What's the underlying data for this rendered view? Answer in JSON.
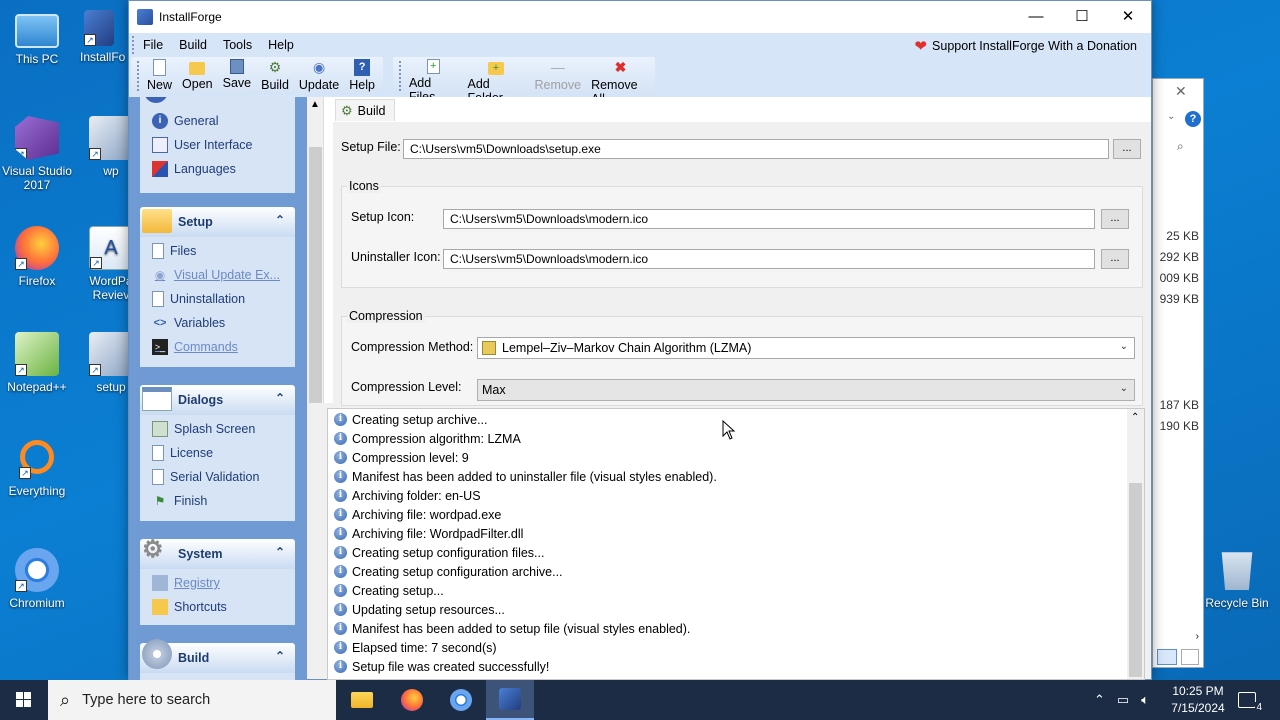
{
  "desktop": {
    "icons": [
      {
        "label": "This PC"
      },
      {
        "label": "InstallFo"
      },
      {
        "label": "Visual Studio 2017"
      },
      {
        "label": "wp"
      },
      {
        "label": "Firefox"
      },
      {
        "label": "WordPa Reviev"
      },
      {
        "label": "Notepad++"
      },
      {
        "label": "setup"
      },
      {
        "label": "Everything"
      },
      {
        "label": "Chromium"
      }
    ],
    "recycle_bin": "Recycle Bin",
    "bg_window_sizes": [
      "25 KB",
      "292 KB",
      "009 KB",
      "939 KB",
      "187 KB",
      "190 KB"
    ]
  },
  "window": {
    "title": "InstallForge",
    "controls": {
      "minimize": "—",
      "maximize": "☐",
      "close": "✕"
    }
  },
  "menu": {
    "items": [
      "File",
      "Build",
      "Tools",
      "Help"
    ],
    "donation": "Support InstallForge With a Donation"
  },
  "toolbar": {
    "group1": [
      {
        "label": "New",
        "icon": "new-file-icon"
      },
      {
        "label": "Open",
        "icon": "open-folder-icon"
      },
      {
        "label": "Save",
        "icon": "save-icon"
      },
      {
        "label": "Build",
        "icon": "build-gear-icon"
      },
      {
        "label": "Update",
        "icon": "update-icon"
      },
      {
        "label": "Help",
        "icon": "help-book-icon"
      }
    ],
    "group2": [
      {
        "label": "Add Files",
        "icon": "add-file-icon"
      },
      {
        "label": "Add Folder",
        "icon": "add-folder-icon"
      },
      {
        "label": "Remove",
        "icon": "remove-icon",
        "disabled": true
      },
      {
        "label": "Remove All",
        "icon": "remove-all-icon"
      }
    ]
  },
  "sidebar": {
    "general_items": [
      "General",
      "User Interface",
      "Languages"
    ],
    "setup": {
      "title": "Setup",
      "items": [
        "Files",
        "Visual Update Ex...",
        "Uninstallation",
        "Variables",
        "Commands"
      ]
    },
    "dialogs": {
      "title": "Dialogs",
      "items": [
        "Splash Screen",
        "License",
        "Serial Validation",
        "Finish"
      ]
    },
    "system": {
      "title": "System",
      "items": [
        "Registry",
        "Shortcuts"
      ]
    },
    "build": {
      "title": "Build"
    },
    "collapse_glyph": "⌃"
  },
  "build_page": {
    "tab": "Build",
    "setup_file_label": "Setup File:",
    "setup_file_value": "C:\\Users\\vm5\\Downloads\\setup.exe",
    "icons_group": "Icons",
    "setup_icon_label": "Setup Icon:",
    "setup_icon_value": "C:\\Users\\vm5\\Downloads\\modern.ico",
    "uninstaller_icon_label": "Uninstaller Icon:",
    "uninstaller_icon_value": "C:\\Users\\vm5\\Downloads\\modern.ico",
    "browse": "...",
    "compression_group": "Compression",
    "method_label": "Compression Method:",
    "method_value": "Lempel–Ziv–Markov Chain Algorithm (LZMA)",
    "level_label": "Compression Level:",
    "level_value": "Max"
  },
  "log": [
    "Creating setup archive...",
    "Compression algorithm: LZMA",
    "Compression level: 9",
    "Manifest has been added to uninstaller file (visual styles enabled).",
    "Archiving folder: en-US",
    "Archiving file: wordpad.exe",
    "Archiving file: WordpadFilter.dll",
    "Creating setup configuration files...",
    "Creating setup configuration archive...",
    "Creating setup...",
    "Updating setup resources...",
    "Manifest has been added to setup file (visual styles enabled).",
    "Elapsed time: 7 second(s)",
    "Setup file was created successfully!"
  ],
  "taskbar": {
    "search_placeholder": "Type here to search",
    "time": "10:25 PM",
    "date": "7/15/2024",
    "notification_count": "4"
  }
}
